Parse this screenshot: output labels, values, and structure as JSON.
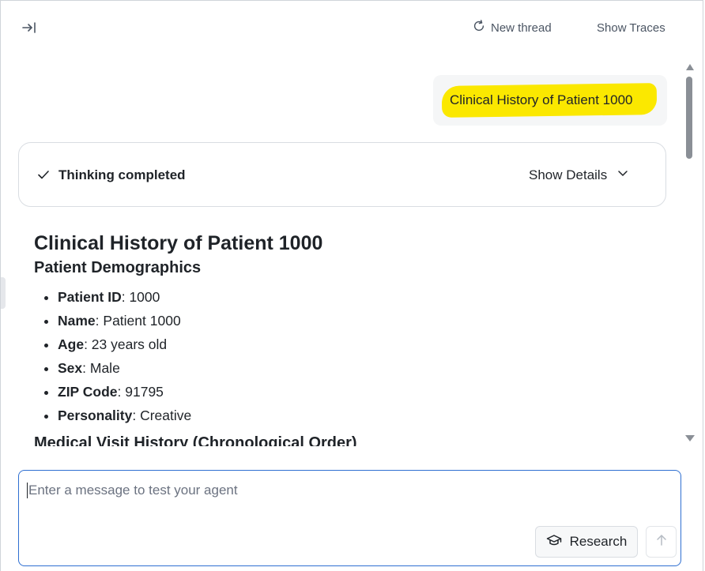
{
  "topbar": {
    "collapse_icon": "collapse-panel-icon",
    "new_thread_label": "New thread",
    "new_thread_icon": "refresh-icon",
    "show_traces_label": "Show Traces"
  },
  "thread": {
    "user_message": "Clinical History of Patient 1000",
    "highlight_color": "#fbe800",
    "thinking": {
      "status_label": "Thinking completed",
      "details_label": "Show Details"
    },
    "response": {
      "title": "Clinical History of Patient 1000",
      "section_demographics": "Patient Demographics",
      "facts": [
        {
          "key": "Patient ID",
          "value": ": 1000"
        },
        {
          "key": "Name",
          "value": ": Patient 1000"
        },
        {
          "key": "Age",
          "value": ": 23 years old"
        },
        {
          "key": "Sex",
          "value": ": Male"
        },
        {
          "key": "ZIP Code",
          "value": ": 91795"
        },
        {
          "key": "Personality",
          "value": ": Creative"
        }
      ],
      "section_visits": "Medical Visit History (Chronological Order)"
    }
  },
  "composer": {
    "placeholder": "Enter a message to test your agent",
    "value": "",
    "research_label": "Research",
    "research_icon": "graduation-cap-icon",
    "send_icon": "arrow-up-icon",
    "accent_color": "#2f6fd1"
  }
}
